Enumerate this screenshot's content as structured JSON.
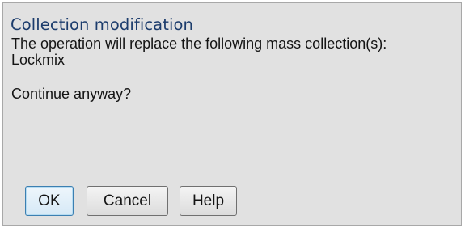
{
  "dialog": {
    "title": "Collection modification",
    "message_lines": [
      "The operation will replace the following mass collection(s):",
      "Lockmix",
      "Continue anyway?"
    ],
    "buttons": {
      "ok_label": "OK",
      "cancel_label": "Cancel",
      "help_label": "Help"
    }
  }
}
